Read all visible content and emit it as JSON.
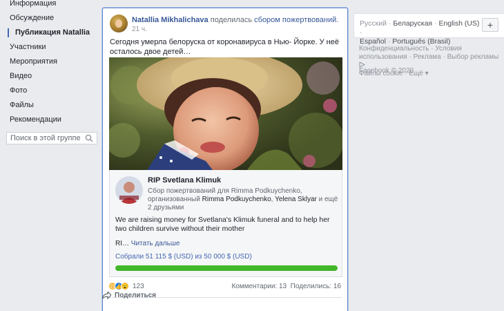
{
  "sidebar": {
    "items": [
      {
        "label": "Информация"
      },
      {
        "label": "Обсуждение"
      },
      {
        "label": "Публикация Natallia"
      },
      {
        "label": "Участники"
      },
      {
        "label": "Мероприятия"
      },
      {
        "label": "Видео"
      },
      {
        "label": "Фото"
      },
      {
        "label": "Файлы"
      },
      {
        "label": "Рекомендации"
      }
    ],
    "search_placeholder": "Поиск в этой группе"
  },
  "post": {
    "author": "Natallia Mikhalichava",
    "action": "поделилась",
    "action_link": "сбором пожертвований.",
    "time": "21 ч.",
    "text": "Сегодня умерла белоруска от коронавируса в Нью- Йорке. У неё осталось двое детей…",
    "fundraiser": {
      "title": "RIP Svetlana Klimuk",
      "org_prefix": "Сбор пожертвований для Rimma Podkuychenko, организованный",
      "org_name_1": "Rimma Podkuychenko",
      "org_sep": ",",
      "org_name_2": "Yelena Sklyar",
      "org_suffix": "и ещё 2 друзьями",
      "description": "We are raising money for Svetlana's Klimuk funeral and to help her two children survive without their mother",
      "truncated": "RI…",
      "read_more": "Читать дальше",
      "raised_text": "Собрали 51 115 $ (USD) из 50 000 $ (USD)",
      "progress": 1.0
    },
    "reaction_count": "123",
    "comments": "Комментарии: 13",
    "shares": "Поделились: 16",
    "share_label": "Поделиться"
  },
  "right": {
    "languages": {
      "current": "Русский",
      "others": [
        "Беларуская",
        "English (US)",
        "Español",
        "Português (Brasil)"
      ],
      "separator": "·"
    },
    "plus": "+",
    "footer_line1": [
      "Конфиденциальность",
      "Условия",
      "использования",
      "Реклама",
      "Выбор рекламы"
    ],
    "footer_line2": [
      "Файлы cookie",
      "Ещё"
    ],
    "copyright": "Facebook © 2020"
  },
  "colors": {
    "link": "#385898",
    "progress": "#42b72a",
    "focus_border": "#5b86d0"
  }
}
